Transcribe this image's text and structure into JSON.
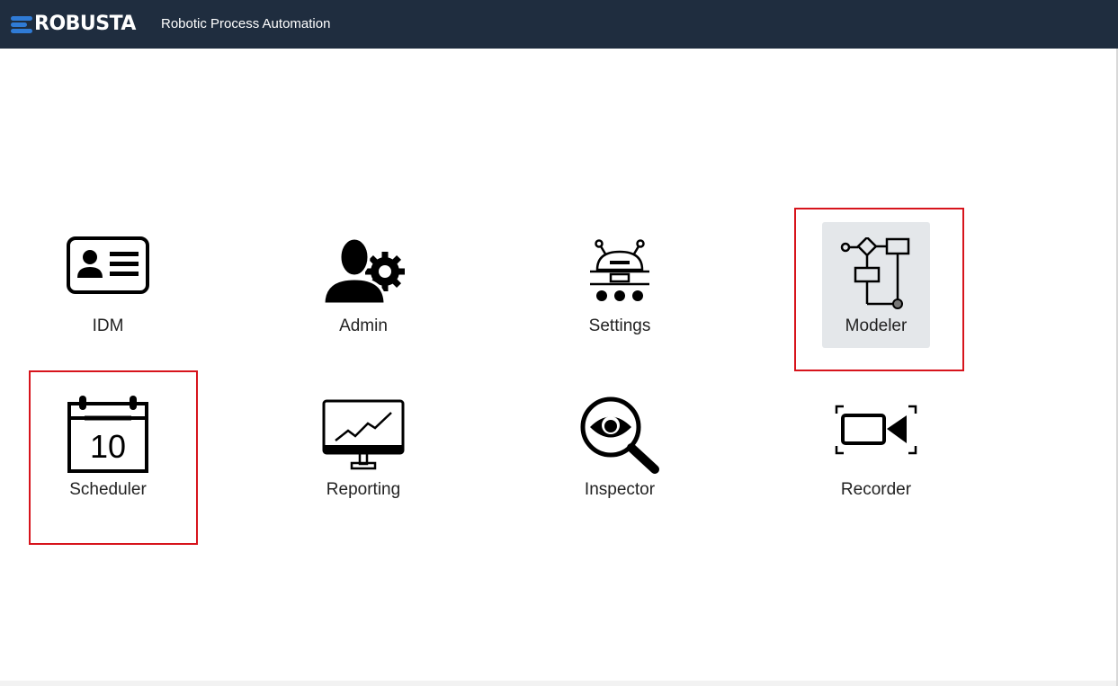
{
  "header": {
    "logo_text": "ROBUSTA",
    "app_title": "Robotic Process Automation",
    "background_color": "#1f2d3f",
    "logo_accent_color": "#2f7bd6"
  },
  "tiles": [
    {
      "label": "IDM",
      "icon": "id-card-icon",
      "selected": false
    },
    {
      "label": "Admin",
      "icon": "admin-user-gear-icon",
      "selected": false
    },
    {
      "label": "Settings",
      "icon": "robot-settings-icon",
      "selected": false
    },
    {
      "label": "Modeler",
      "icon": "flowchart-icon",
      "selected": true
    },
    {
      "label": "Scheduler",
      "icon": "calendar-icon",
      "selected": false,
      "calendar_day": "10"
    },
    {
      "label": "Reporting",
      "icon": "monitor-chart-icon",
      "selected": false
    },
    {
      "label": "Inspector",
      "icon": "eye-magnifier-icon",
      "selected": false
    },
    {
      "label": "Recorder",
      "icon": "video-camera-icon",
      "selected": false
    }
  ],
  "highlight_color": "#d7141c"
}
